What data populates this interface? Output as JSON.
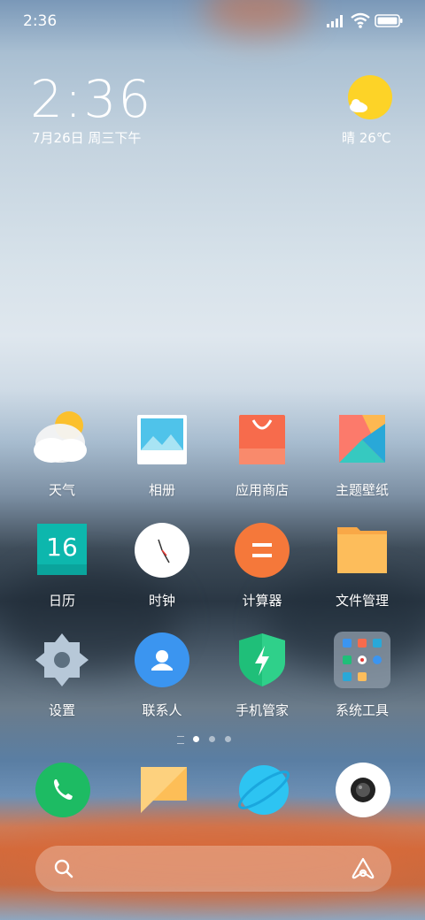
{
  "status_bar": {
    "time": "2:36"
  },
  "clock_widget": {
    "time": "2:36",
    "date": "7月26日 周三下午",
    "weather": "晴 26℃"
  },
  "apps": [
    {
      "label": "天气"
    },
    {
      "label": "相册"
    },
    {
      "label": "应用商店"
    },
    {
      "label": "主题壁纸"
    },
    {
      "label": "日历"
    },
    {
      "label": "时钟"
    },
    {
      "label": "计算器"
    },
    {
      "label": "文件管理"
    },
    {
      "label": "设置"
    },
    {
      "label": "联系人"
    },
    {
      "label": "手机管家"
    },
    {
      "label": "系统工具"
    }
  ],
  "calendar_day": "16",
  "dock": [
    "phone-icon",
    "messages-icon",
    "browser-icon",
    "camera-icon"
  ],
  "page_indicator": {
    "current_page": 1,
    "total_pages": 3
  },
  "colors": {
    "phone": "#1dbb63",
    "messages": "#fdbe57",
    "browser": "#2dc4f2",
    "calculator": "#f5783a"
  }
}
